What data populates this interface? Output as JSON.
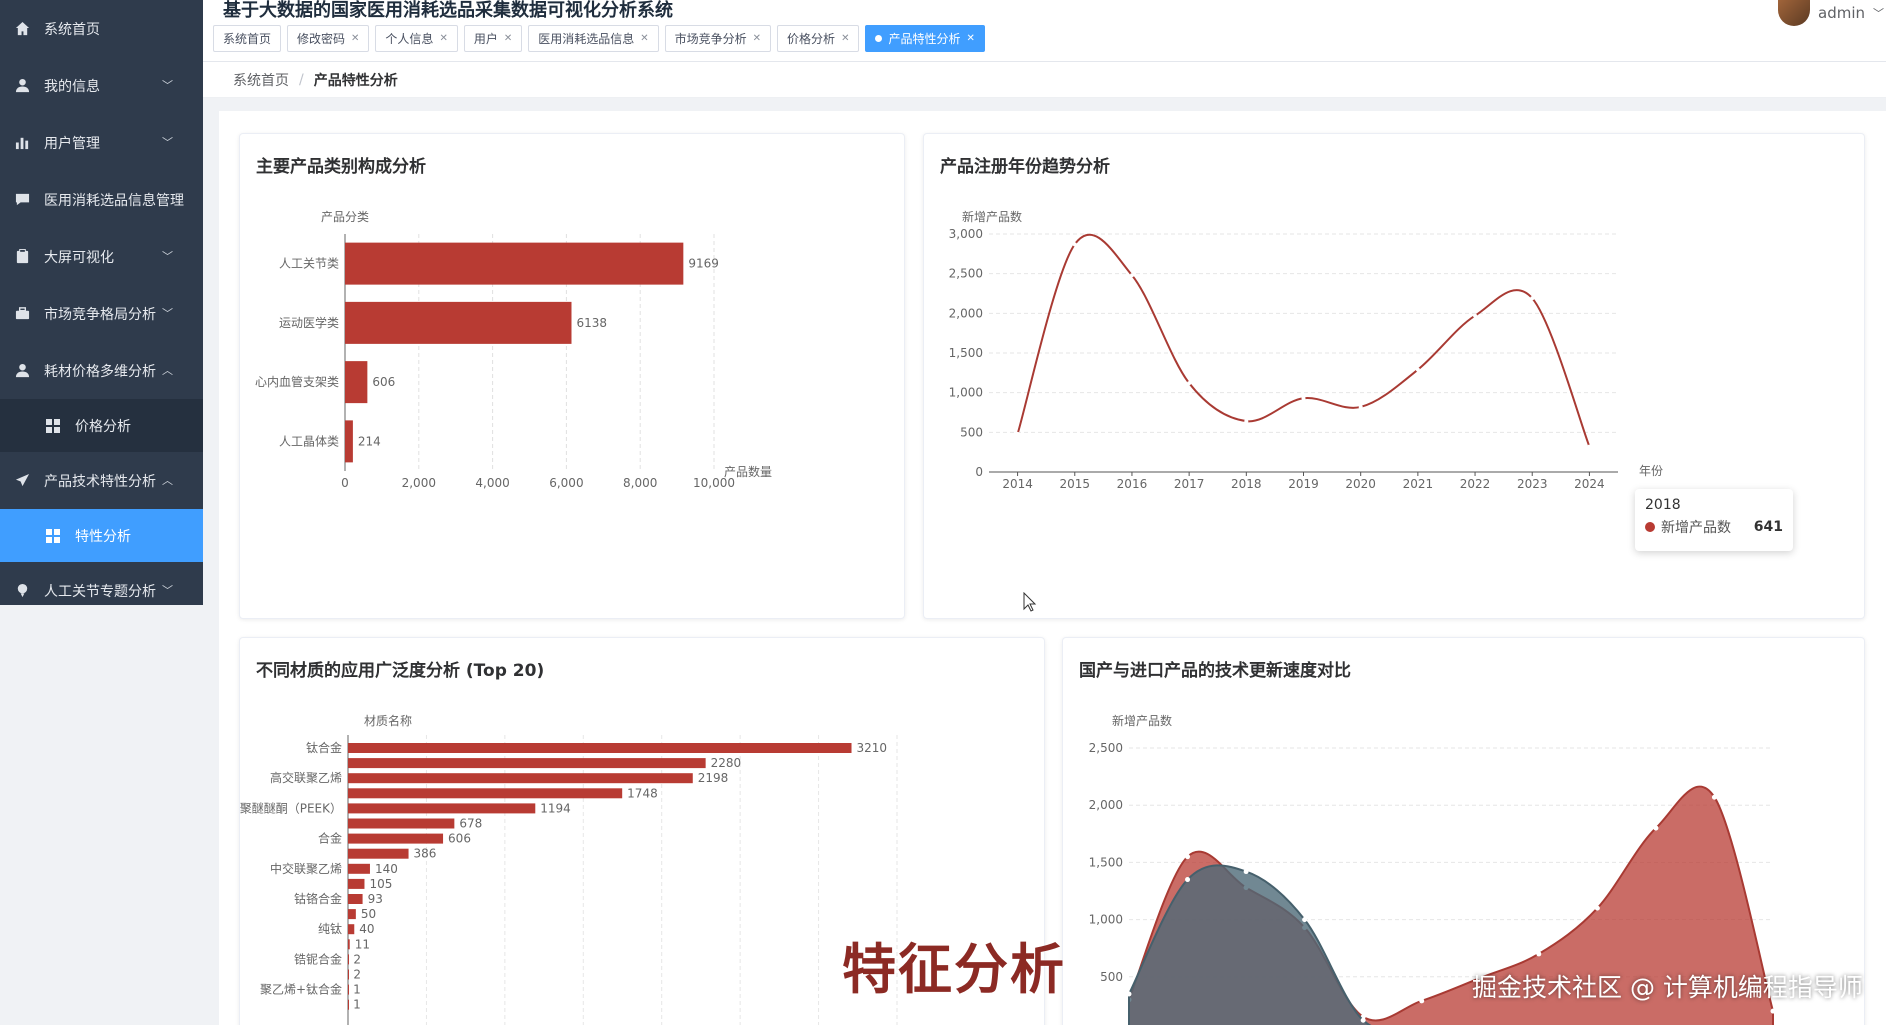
{
  "app": {
    "title": "基于大数据的国家医用消耗选品采集数据可视化分析系统",
    "user": "admin"
  },
  "sidebar": {
    "items": [
      {
        "label": "系统首页",
        "icon": "home-icon",
        "chev": ""
      },
      {
        "label": "我的信息",
        "icon": "user-icon",
        "chev": "﹀"
      },
      {
        "label": "用户管理",
        "icon": "bar-chart-icon",
        "chev": "﹀"
      },
      {
        "label": "医用消耗选品信息管理",
        "icon": "chat-icon",
        "chev": ""
      },
      {
        "label": "大屏可视化",
        "icon": "clipboard-icon",
        "chev": "﹀"
      },
      {
        "label": "市场竞争格局分析",
        "icon": "briefcase-icon",
        "chev": "﹀"
      },
      {
        "label": "耗材价格多维分析",
        "icon": "user-icon",
        "chev": "︿"
      },
      {
        "label": "价格分析",
        "icon": "grid-icon",
        "sub": true
      },
      {
        "label": "产品技术特性分析",
        "icon": "send-icon",
        "chev": "︿"
      },
      {
        "label": "特性分析",
        "icon": "grid-icon",
        "sub": true,
        "active": true
      },
      {
        "label": "人工关节专题分析",
        "icon": "pin-icon",
        "chev": "﹀"
      }
    ]
  },
  "tags": [
    {
      "label": "系统首页",
      "closable": false
    },
    {
      "label": "修改密码",
      "closable": true
    },
    {
      "label": "个人信息",
      "closable": true
    },
    {
      "label": "用户",
      "closable": true
    },
    {
      "label": "医用消耗选品信息",
      "closable": true
    },
    {
      "label": "市场竞争分析",
      "closable": true
    },
    {
      "label": "价格分析",
      "closable": true
    },
    {
      "label": "产品特性分析",
      "closable": true,
      "active": true
    }
  ],
  "breadcrumb": {
    "home": "系统首页",
    "sep": "/",
    "current": "产品特性分析"
  },
  "colors": {
    "accent": "#409eff",
    "bar": "#b83b33",
    "dark_series": "#4e6a78"
  },
  "chart_data": [
    {
      "type": "bar",
      "title": "主要产品类别构成分析",
      "ylabel": "产品分类",
      "xlabel": "产品数量",
      "categories": [
        "人工关节类",
        "运动医学类",
        "心内血管支架类",
        "人工晶体类"
      ],
      "values": [
        9169,
        6138,
        606,
        214
      ],
      "xlim": [
        0,
        10000
      ],
      "xticks": [
        "0",
        "2,000",
        "4,000",
        "6,000",
        "8,000",
        "10,000"
      ]
    },
    {
      "type": "line",
      "title": "产品注册年份趋势分析",
      "ylabel": "新增产品数",
      "xlabel": "年份",
      "x": [
        "2014",
        "2015",
        "2016",
        "2017",
        "2018",
        "2019",
        "2020",
        "2021",
        "2022",
        "2023",
        "2024"
      ],
      "series": [
        {
          "name": "新增产品数",
          "values": [
            480,
            2870,
            2480,
            1120,
            641,
            930,
            820,
            1290,
            1970,
            2190,
            320
          ]
        }
      ],
      "ylim": [
        0,
        3000
      ],
      "yticks": [
        "0",
        "500",
        "1,000",
        "1,500",
        "2,000",
        "2,500",
        "3,000"
      ],
      "tooltip": {
        "year": "2018",
        "label": "新增产品数",
        "value": "641"
      }
    },
    {
      "type": "bar",
      "title": "不同材质的应用广泛度分析 (Top 20)",
      "ylabel": "材质名称",
      "categories": [
        "钛合金",
        "",
        "高交联聚乙烯",
        "",
        "聚醚醚酮（PEEK）",
        "",
        "合金",
        "",
        "中交联聚乙烯",
        "",
        "钴铬合金",
        "",
        "纯钛",
        "",
        "锆铌合金",
        "",
        "聚乙烯+钛合金",
        ""
      ],
      "values": [
        3210,
        2280,
        2198,
        1748,
        1194,
        678,
        606,
        386,
        140,
        105,
        93,
        50,
        40,
        11,
        2,
        2,
        1,
        1
      ],
      "xlim": [
        0,
        3500
      ]
    },
    {
      "type": "area",
      "title": "国产与进口产品的技术更新速度对比",
      "ylabel": "新增产品数",
      "yticks": [
        "500",
        "1,000",
        "1,500",
        "2,000",
        "2,500"
      ],
      "ylim": [
        0,
        2500
      ],
      "series": [
        {
          "values": [
            300,
            1550,
            1280,
            930,
            150,
            290,
            490,
            700,
            1100,
            1800,
            2070,
            200
          ]
        },
        {
          "values": [
            350,
            1350,
            1420,
            1000,
            120,
            40,
            30,
            20,
            10,
            10,
            5,
            0
          ]
        }
      ]
    }
  ],
  "overlay": {
    "big": "特征分析",
    "watermark": "掘金技术社区 @ 计算机编程指导师"
  }
}
